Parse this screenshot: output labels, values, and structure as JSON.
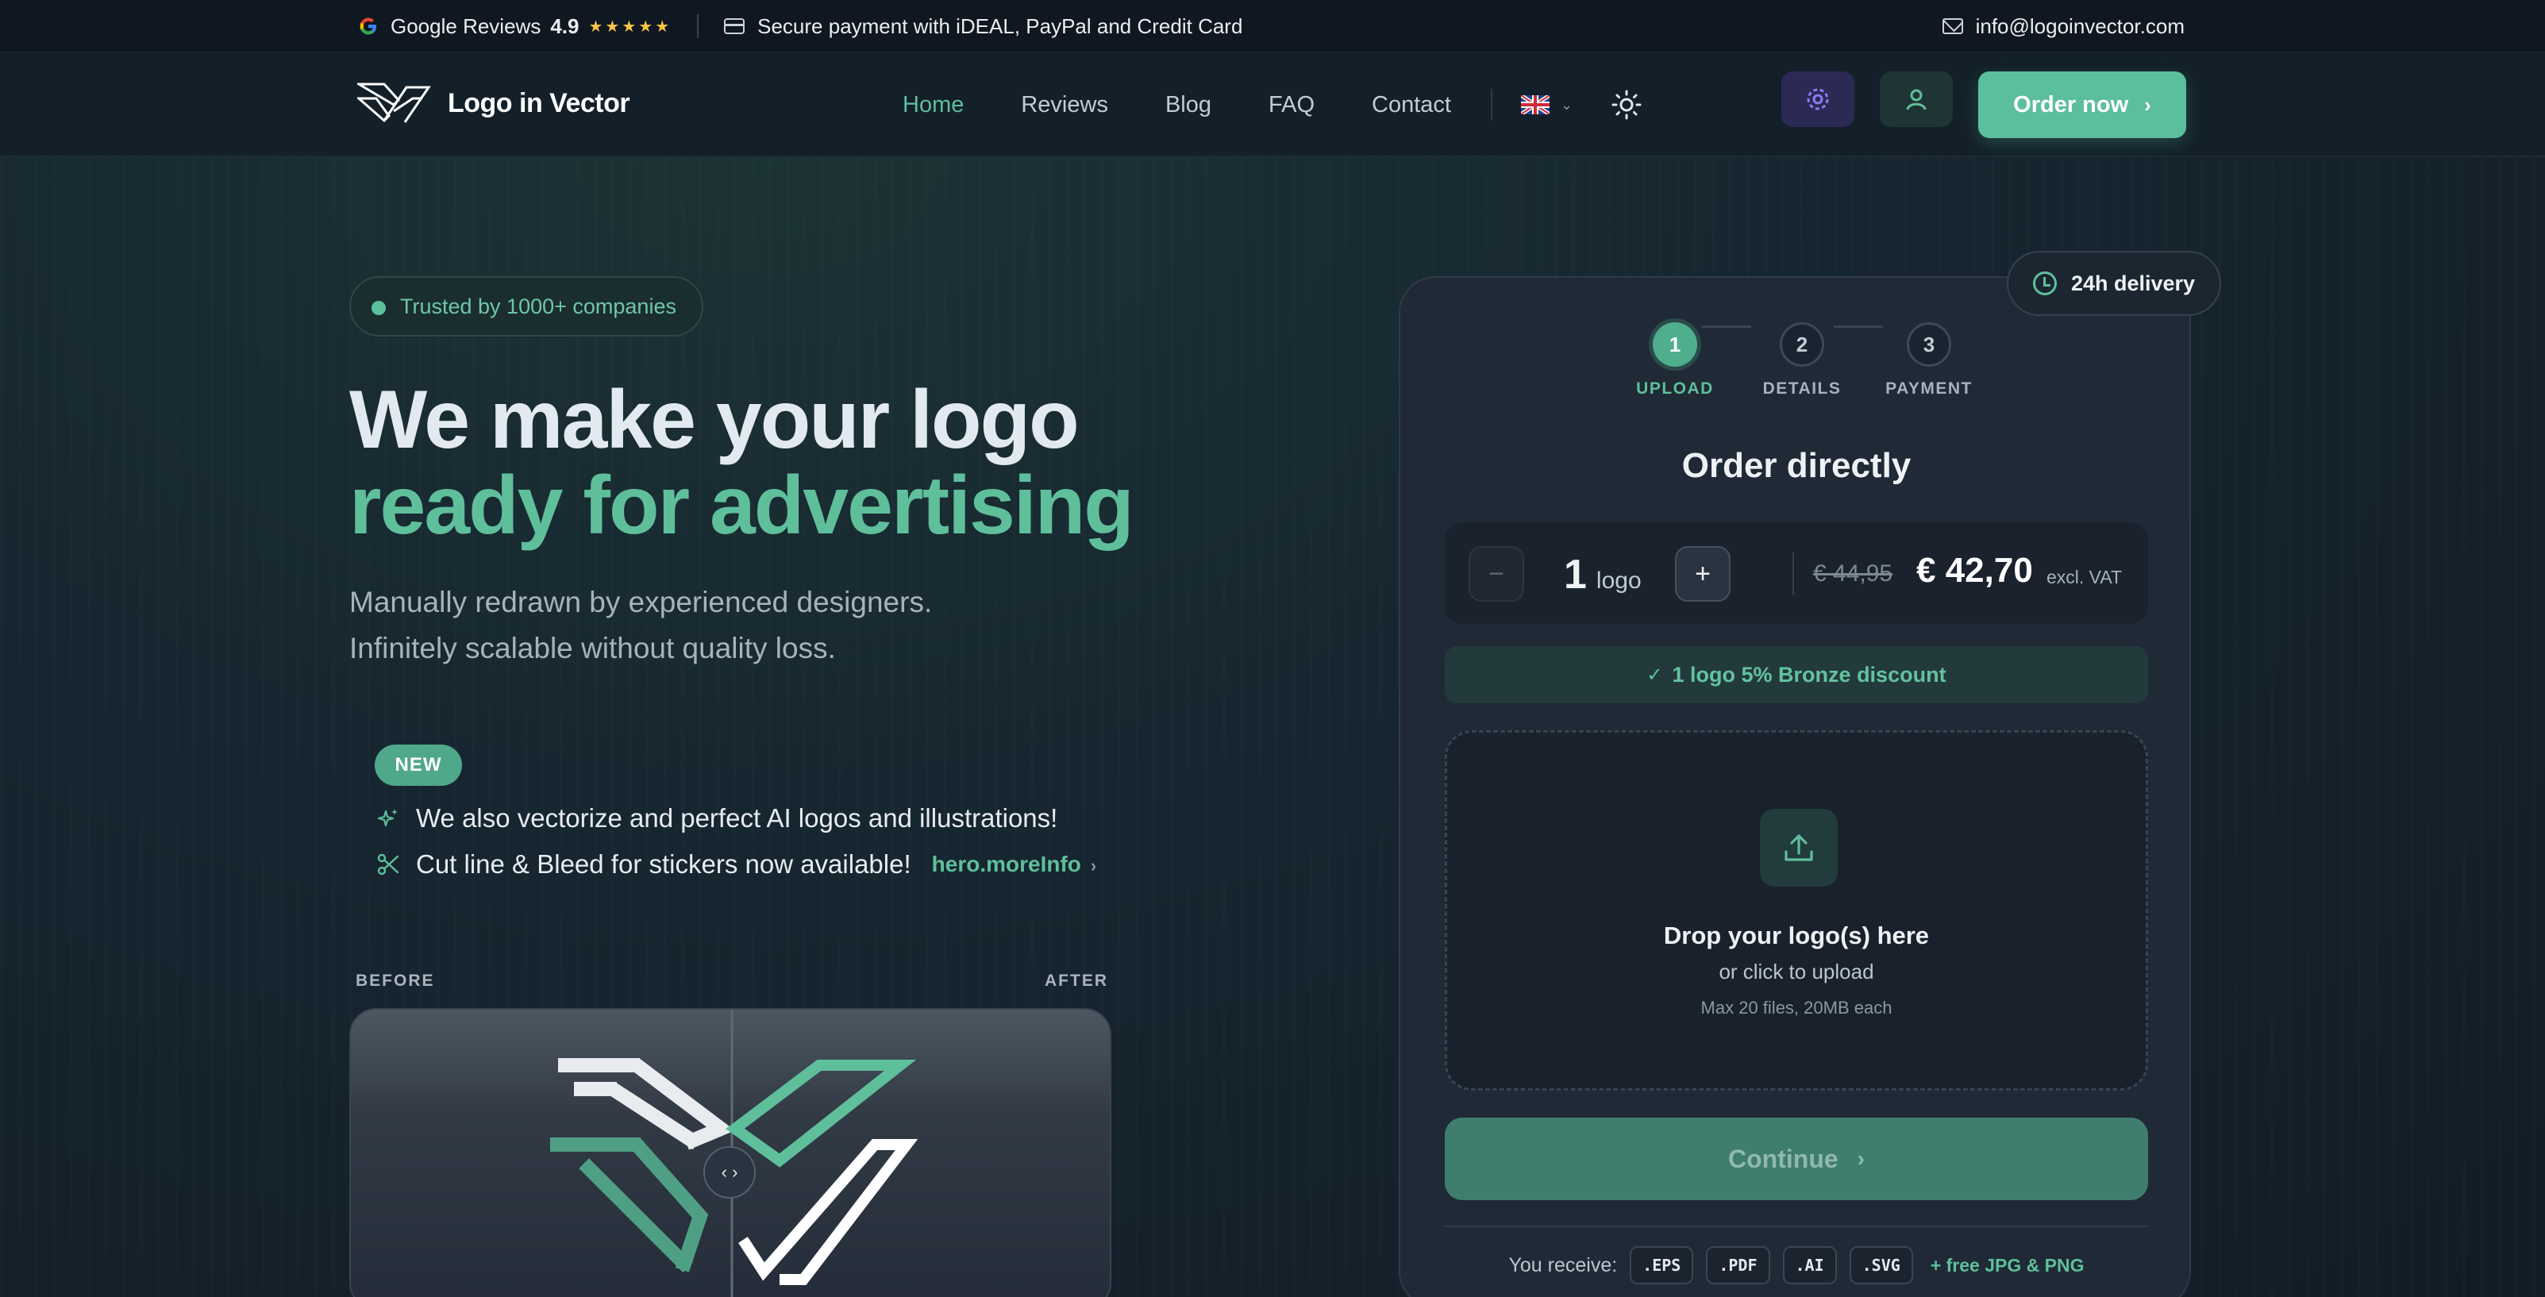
{
  "topbar": {
    "reviews_label": "Google Reviews",
    "rating": "4.9",
    "stars": "★★★★★",
    "payment_text": "Secure payment with iDEAL, PayPal and Credit Card",
    "email": "info@logoinvector.com"
  },
  "nav": {
    "brand": "Logo in Vector",
    "links": [
      "Home",
      "Reviews",
      "Blog",
      "FAQ",
      "Contact"
    ],
    "active_link": "Home",
    "order_button": "Order now"
  },
  "hero": {
    "trust_badge": "Trusted by 1000+ companies",
    "headline_1": "We make your logo",
    "headline_2": "ready for advertising",
    "subline_1": "Manually redrawn by experienced designers.",
    "subline_2": "Infinitely scalable without quality loss.",
    "new_badge": "NEW",
    "feature_1": "We also vectorize and perfect AI logos and illustrations!",
    "feature_2": "Cut line & Bleed for stickers now available!",
    "more_info": "hero.moreInfo",
    "before_label": "BEFORE",
    "after_label": "AFTER"
  },
  "order": {
    "delivery_badge": "24h delivery",
    "steps": [
      {
        "number": "1",
        "label": "UPLOAD"
      },
      {
        "number": "2",
        "label": "DETAILS"
      },
      {
        "number": "3",
        "label": "PAYMENT"
      }
    ],
    "active_step": 1,
    "title": "Order directly",
    "quantity": "1",
    "quantity_unit": "logo",
    "minus": "−",
    "plus": "+",
    "price_old": "€ 44,95",
    "price_new": "€ 42,70",
    "price_vat": "excl. VAT",
    "discount": "1 logo 5% Bronze discount",
    "drop_title": "Drop your logo(s) here",
    "drop_sub": "or click to upload",
    "drop_note": "Max 20 files, 20MB each",
    "continue": "Continue",
    "receive_label": "You receive:",
    "formats": [
      ".EPS",
      ".PDF",
      ".AI",
      ".SVG"
    ],
    "free_formats": "+ free JPG & PNG"
  },
  "colors": {
    "accent": "#5fbf9b",
    "background": "#142129",
    "card": "#1f2a36",
    "star": "#f6c445"
  }
}
